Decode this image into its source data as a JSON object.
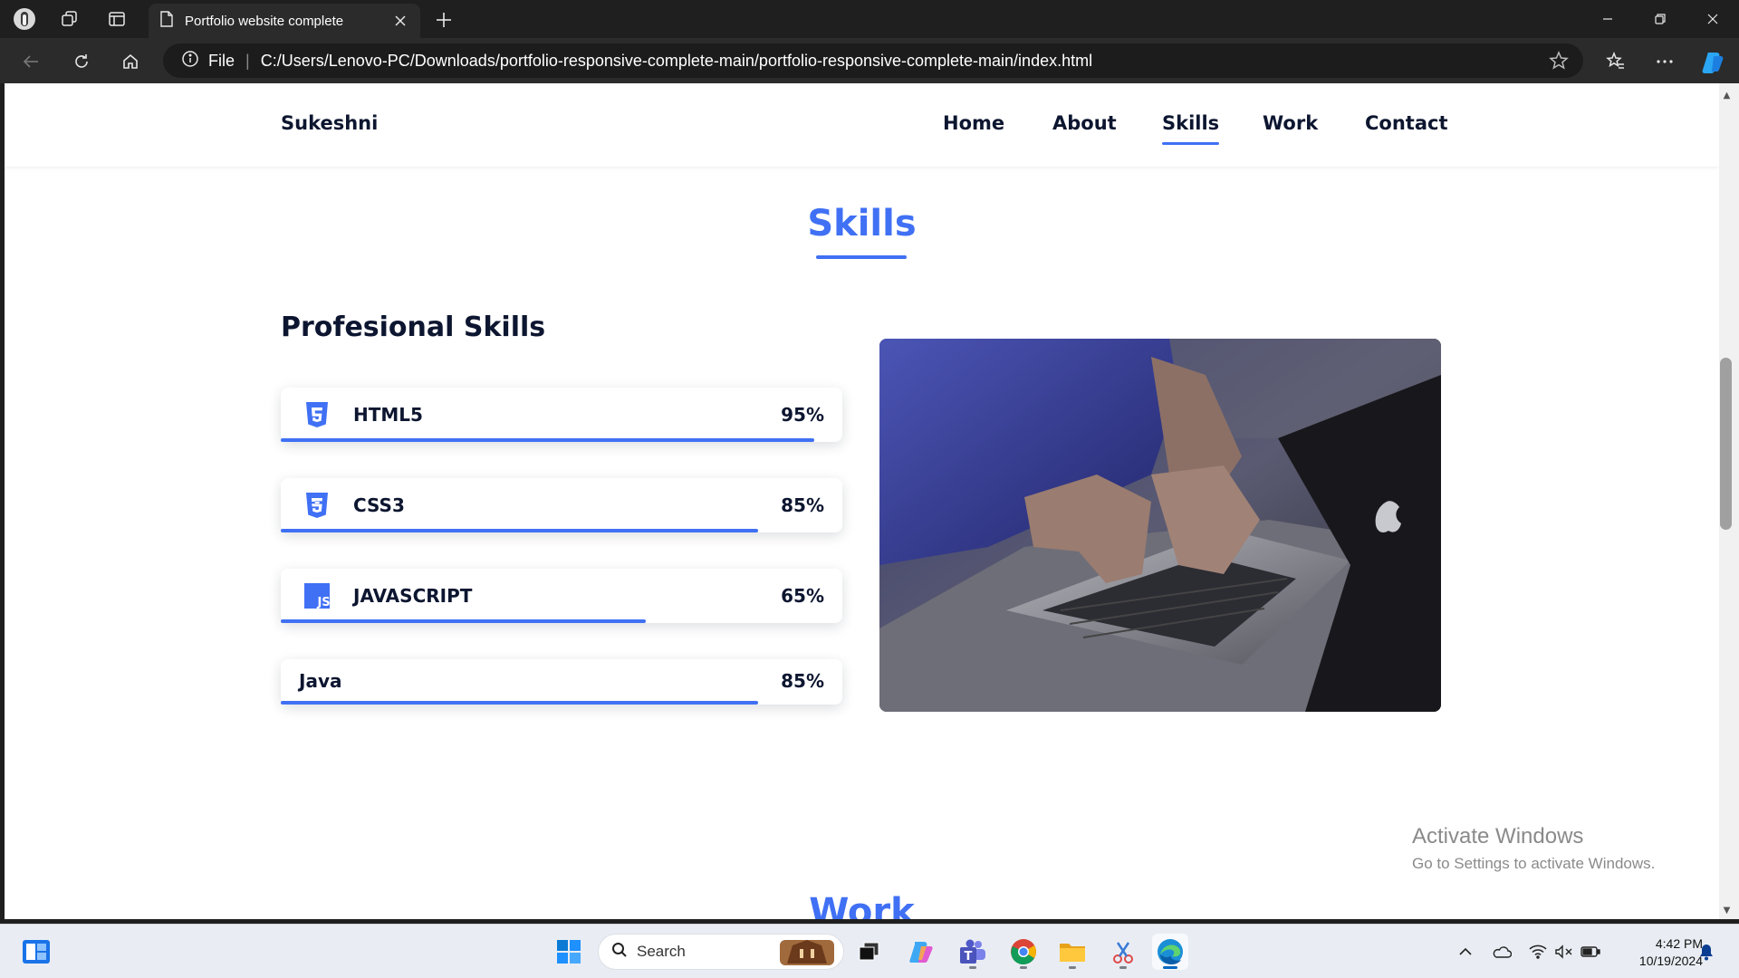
{
  "browser": {
    "tab_title": "Portfolio website complete",
    "address_scheme_label": "File",
    "url": "C:/Users/Lenovo-PC/Downloads/portfolio-responsive-complete-main/portfolio-responsive-complete-main/index.html"
  },
  "site": {
    "logo": "Sukeshni",
    "nav": [
      {
        "label": "Home"
      },
      {
        "label": "About"
      },
      {
        "label": "Skills",
        "active": true
      },
      {
        "label": "Work"
      },
      {
        "label": "Contact"
      }
    ]
  },
  "skills_section": {
    "title": "Skills",
    "subtitle": "Profesional Skills",
    "skills": [
      {
        "name": "HTML5",
        "percent_label": "95%",
        "level": 0.95,
        "icon": "html5-icon"
      },
      {
        "name": "CSS3",
        "percent_label": "85%",
        "level": 0.85,
        "icon": "css3-icon"
      },
      {
        "name": "JAVASCRIPT",
        "percent_label": "65%",
        "level": 0.65,
        "icon": "javascript-icon"
      },
      {
        "name": "Java",
        "percent_label": "85%",
        "level": 0.85,
        "icon": null
      }
    ],
    "image": "person-typing-on-laptop"
  },
  "next_section_title": "Work",
  "watermark": {
    "line1": "Activate Windows",
    "line2": "Go to Settings to activate Windows."
  },
  "taskbar": {
    "search_placeholder": "Search",
    "time": "4:42 PM",
    "date": "10/19/2024"
  },
  "colors": {
    "accent": "#4070f4",
    "text_dark": "#0d1630"
  }
}
